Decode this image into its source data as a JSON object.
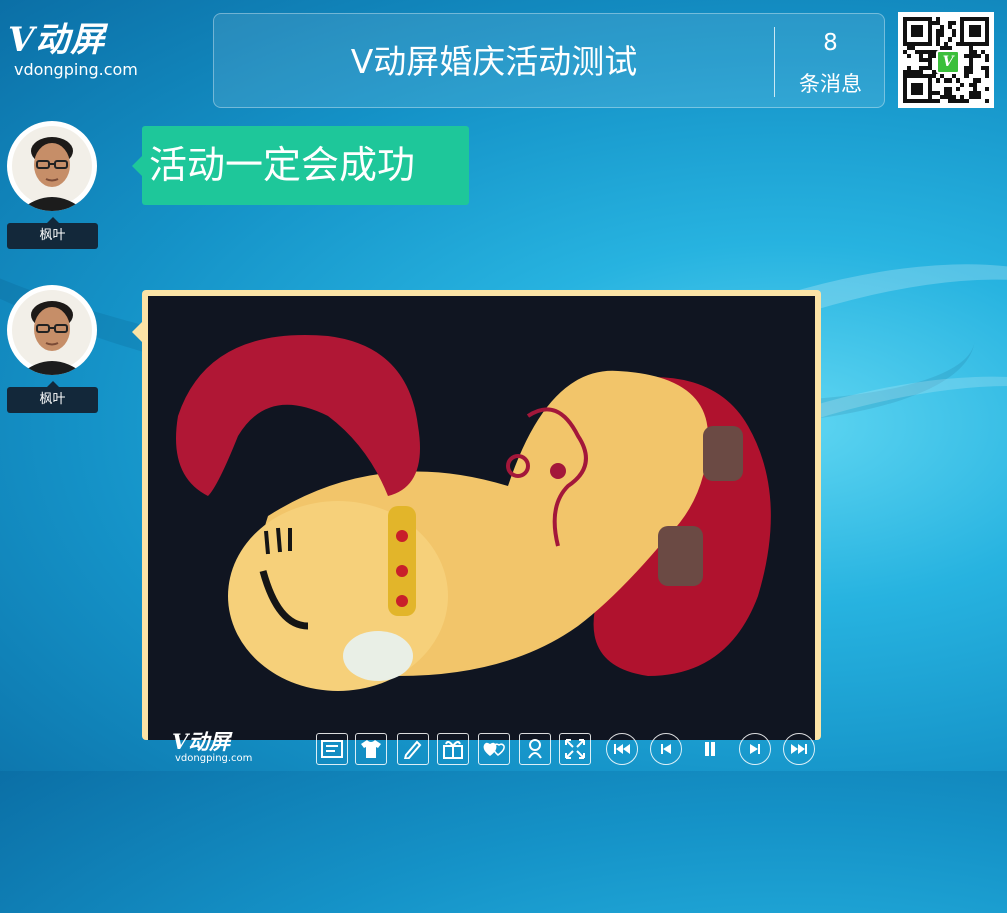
{
  "brand": {
    "logo_text": "V动屏",
    "logo_url": "vdongping.com"
  },
  "header": {
    "title": "V动屏婚庆活动测试",
    "message_count": "8",
    "message_label": "条消息"
  },
  "qr_code": {
    "badge_letter": "V"
  },
  "messages": [
    {
      "user": "枫叶",
      "type": "text",
      "text": "活动一定会成功",
      "bubble_color": "#1ec79a"
    },
    {
      "user": "枫叶",
      "type": "image",
      "image_description": "plush toy goat",
      "frame_color": "#fbe3a6"
    }
  ],
  "bottom_bar": {
    "logo_text": "V动屏",
    "logo_url": "vdongping.com",
    "tools": [
      {
        "name": "wall-list-icon"
      },
      {
        "name": "shirt-icon"
      },
      {
        "name": "pen-icon"
      },
      {
        "name": "gift-icon"
      },
      {
        "name": "hearts-icon"
      },
      {
        "name": "lucky-draw-icon"
      },
      {
        "name": "fullscreen-icon"
      }
    ],
    "controls": [
      {
        "name": "first-icon"
      },
      {
        "name": "previous-icon"
      },
      {
        "name": "pause-icon"
      },
      {
        "name": "next-icon"
      },
      {
        "name": "last-icon"
      }
    ]
  },
  "colors": {
    "background": "#1593c8",
    "text_bubble": "#1ec79a",
    "image_frame": "#fbe3a6",
    "name_tag": "#13283a"
  }
}
